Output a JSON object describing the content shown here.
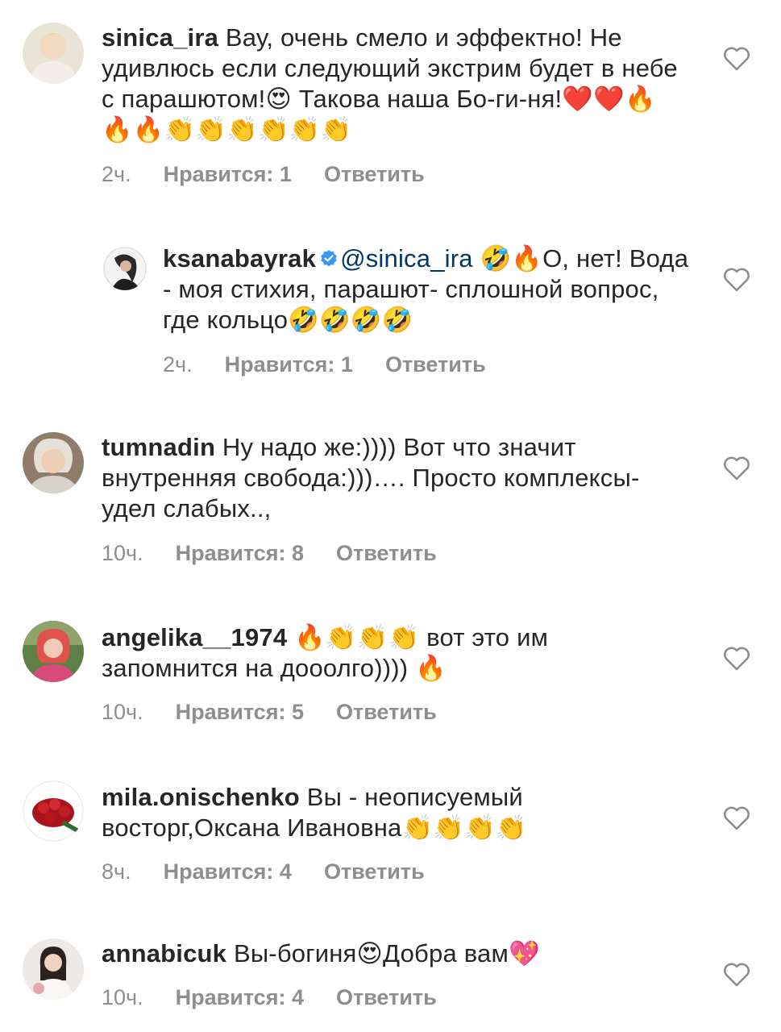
{
  "comments": [
    {
      "username": "sinica_ira",
      "text": " Вау, очень смело и эффектно! Не удивлюсь если следующий экстрим будет в небе с парашютом!😍 Такова наша Бо-ги-ня!❤️❤️🔥🔥🔥👏👏👏👏👏👏",
      "time": "2ч.",
      "likes": "Нравится: 1",
      "reply": "Ответить"
    },
    {
      "username": "ksanabayrak",
      "mention": "@sinica_ira",
      "text": " 🤣🔥О, нет! Вода - моя стихия, парашют- сплошной вопрос, где кольцо🤣🤣🤣🤣",
      "time": "2ч.",
      "likes": "Нравится: 1",
      "reply": "Ответить"
    },
    {
      "username": "tumnadin",
      "text": " Ну надо же:)))) Вот что значит внутренняя свобода:)))…. Просто комплексы-удел слабых..,",
      "time": "10ч.",
      "likes": "Нравится: 8",
      "reply": "Ответить"
    },
    {
      "username": "angelika__1974",
      "text": " 🔥👏👏👏 вот это им запомнится на дооолго)))) 🔥",
      "time": "10ч.",
      "likes": "Нравится: 5",
      "reply": "Ответить"
    },
    {
      "username": "mila.onischenko",
      "text": " Вы - неописуемый восторг,Оксана Ивановна👏👏👏👏",
      "time": "8ч.",
      "likes": "Нравится: 4",
      "reply": "Ответить"
    },
    {
      "username": "annabicuk",
      "text": " Вы-богиня😍Добра вам💖",
      "time": "10ч.",
      "likes": "Нравится: 4",
      "reply": "Ответить"
    }
  ],
  "icons": {
    "like": "heart-outline-icon",
    "verified": "verified-badge-icon"
  },
  "colors": {
    "text": "#262626",
    "meta": "#8e8e8e",
    "mention": "#00376b",
    "verified": "#3897f0"
  }
}
